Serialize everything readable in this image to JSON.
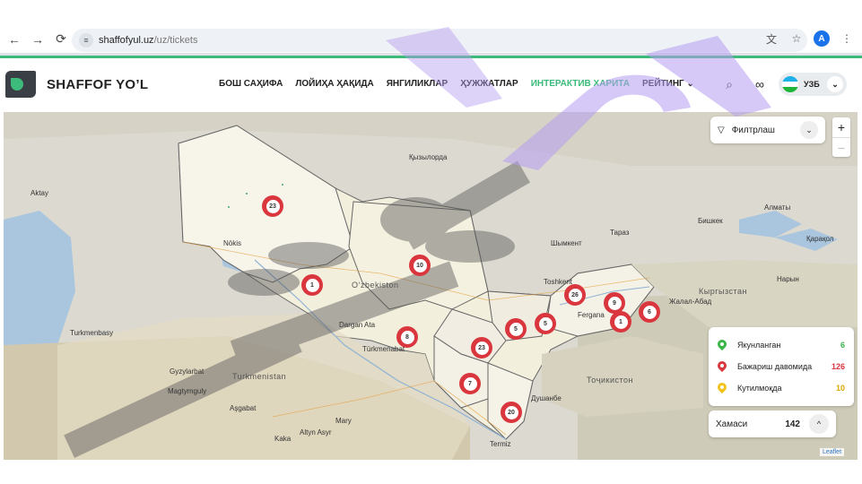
{
  "browser": {
    "url_host": "shaffofyul.uz",
    "url_path": "/uz/tickets",
    "profile_initial": "A"
  },
  "header": {
    "logo_text": "SHAFFOF YO’L",
    "nav": [
      {
        "label": "БОШ САҲИФА",
        "active": false
      },
      {
        "label": "ЛОЙИҲА ҲАҚИДА",
        "active": false
      },
      {
        "label": "ЯНГИЛИКЛАР",
        "active": false
      },
      {
        "label": "ҲУЖЖАТЛАР",
        "active": false
      },
      {
        "label": "ИНТЕРАКТИВ ХАРИТА",
        "active": true
      },
      {
        "label": "РЕЙТИНГ",
        "active": false
      }
    ],
    "language": "УЗБ"
  },
  "map": {
    "filter_label": "Филтрлаш",
    "zoom_in": "+",
    "zoom_out": "−",
    "country_labels": [
      "Oʻzbekiston",
      "Turkmenistan",
      "Кыргызстан",
      "Тоҷикистон"
    ],
    "city_labels": [
      "Nökis",
      "Toshkent",
      "Шымкент",
      "Тараз",
      "Бишкек",
      "Алматы",
      "Қарақол",
      "Душанбе",
      "Termiz",
      "Mary",
      "Aşgabat",
      "Türkmenabat",
      "Dargan Ata",
      "Қызылорда",
      "Нарын",
      "Жалал-Абад",
      "Fergana",
      "Gyzylarbat",
      "Magtymguly",
      "Kaka",
      "Altyn Asyr",
      "Turkmenbasy",
      "Aktay"
    ],
    "markers": [
      {
        "value": "23",
        "color": "#d9363e"
      },
      {
        "value": "10",
        "color": "#d9363e"
      },
      {
        "value": "1",
        "color": "#d9363e"
      },
      {
        "value": "8",
        "color": "#d9363e"
      },
      {
        "value": "23",
        "color": "#d9363e"
      },
      {
        "value": "5",
        "color": "#d9363e"
      },
      {
        "value": "5",
        "color": "#d9363e"
      },
      {
        "value": "26",
        "color": "#d9363e"
      },
      {
        "value": "9",
        "color": "#d9363e"
      },
      {
        "value": "1",
        "color": "#d9363e"
      },
      {
        "value": "6",
        "color": "#d9363e"
      },
      {
        "value": "7",
        "color": "#d9363e"
      },
      {
        "value": "20",
        "color": "#d9363e"
      }
    ],
    "legend": [
      {
        "label": "Якунланган",
        "count": "6",
        "color": "#39b54a"
      },
      {
        "label": "Бажариш давомида",
        "count": "126",
        "color": "#d9363e"
      },
      {
        "label": "Кутилмоқда",
        "count": "10",
        "color": "#f2c21b"
      }
    ],
    "total_label": "Хамаси",
    "total_value": "142",
    "attribution": "Leaflet"
  },
  "colors": {
    "accent": "#3dbb7a",
    "marker_red": "#d9363e",
    "watermark_purple": "#b49cf0"
  }
}
